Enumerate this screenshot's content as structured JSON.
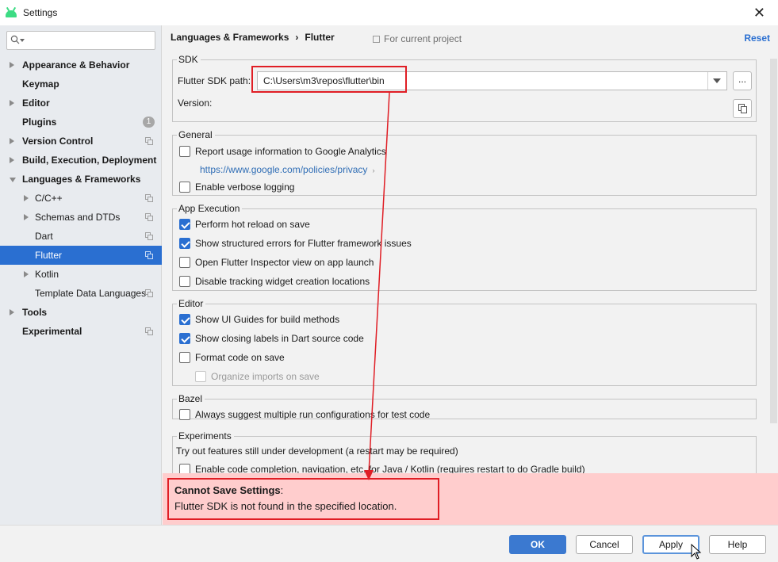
{
  "window": {
    "title": "Settings"
  },
  "sidebar": {
    "search_placeholder": "",
    "items": [
      {
        "label": "Appearance & Behavior",
        "bold": true
      },
      {
        "label": "Keymap",
        "bold": true
      },
      {
        "label": "Editor",
        "bold": true
      },
      {
        "label": "Plugins",
        "bold": true,
        "badge": "1"
      },
      {
        "label": "Version Control",
        "bold": true
      },
      {
        "label": "Build, Execution, Deployment",
        "bold": true
      },
      {
        "label": "Languages & Frameworks",
        "bold": true
      },
      {
        "label": "C/C++"
      },
      {
        "label": "Schemas and DTDs"
      },
      {
        "label": "Dart"
      },
      {
        "label": "Flutter",
        "selected": true
      },
      {
        "label": "Kotlin"
      },
      {
        "label": "Template Data Languages"
      },
      {
        "label": "Tools",
        "bold": true
      },
      {
        "label": "Experimental",
        "bold": true
      }
    ]
  },
  "header": {
    "breadcrumb_parent": "Languages & Frameworks",
    "breadcrumb_sep": "›",
    "breadcrumb_current": "Flutter",
    "scope": "For current project",
    "reset": "Reset"
  },
  "sdk": {
    "group_title": "SDK",
    "path_label": "Flutter SDK path:",
    "path_value": "C:\\Users\\m3\\repos\\flutter\\bin",
    "browse_label": "...",
    "version_label": "Version:"
  },
  "general": {
    "group_title": "General",
    "report_usage": {
      "label": "Report usage information to Google Analytics",
      "checked": false
    },
    "privacy_link": "https://www.google.com/policies/privacy",
    "privacy_chevron": "›",
    "verbose_logging": {
      "label": "Enable verbose logging",
      "checked": false
    }
  },
  "app_execution": {
    "group_title": "App Execution",
    "items": [
      {
        "label": "Perform hot reload on save",
        "checked": true
      },
      {
        "label": "Show structured errors for Flutter framework issues",
        "checked": true
      },
      {
        "label": "Open Flutter Inspector view on app launch",
        "checked": false
      },
      {
        "label": "Disable tracking widget creation locations",
        "checked": false
      }
    ]
  },
  "editor": {
    "group_title": "Editor",
    "items": [
      {
        "label": "Show UI Guides for build methods",
        "checked": true
      },
      {
        "label": "Show closing labels in Dart source code",
        "checked": true
      },
      {
        "label": "Format code on save",
        "checked": false
      },
      {
        "label": "Organize imports on save",
        "checked": false,
        "disabled": true
      }
    ]
  },
  "bazel": {
    "group_title": "Bazel",
    "multi_run": {
      "label": "Always suggest multiple run configurations for test code",
      "checked": false
    }
  },
  "experiments": {
    "group_title": "Experiments",
    "description": "Try out features still under development (a restart may be required)",
    "code_completion": {
      "label": "Enable code completion, navigation, etc. for Java / Kotlin (requires restart to do Gradle build)",
      "checked": false
    }
  },
  "error": {
    "title": "Cannot Save Settings",
    "title_suffix": ":",
    "message": "Flutter SDK is not found in the specified location."
  },
  "footer": {
    "ok": "OK",
    "cancel": "Cancel",
    "apply": "Apply",
    "help": "Help"
  },
  "colors": {
    "accent": "#2a6fd1",
    "error_bg": "#ffcdcd",
    "annotation": "#e01e25"
  }
}
